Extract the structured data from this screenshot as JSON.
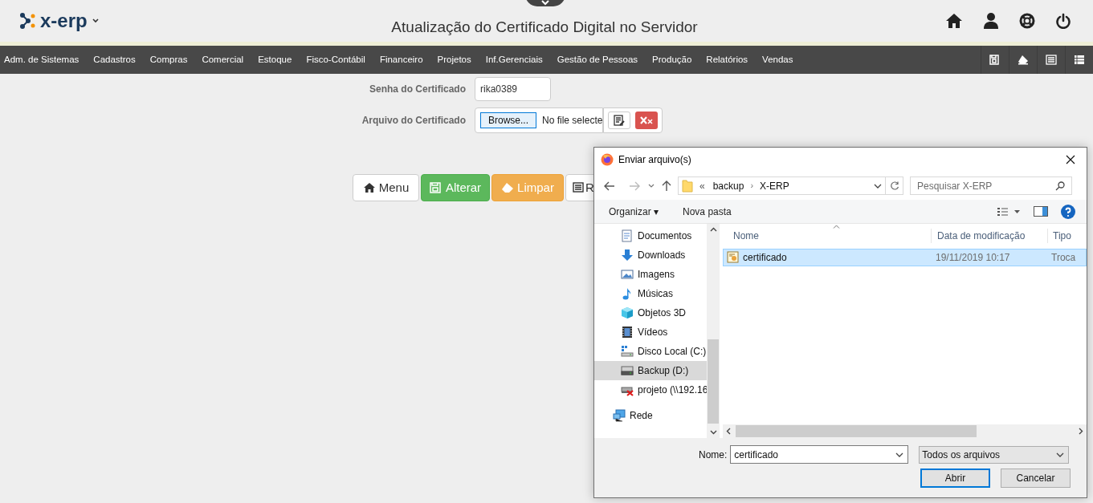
{
  "header": {
    "logo": "x-erp",
    "title": "Atualização do Certificado Digital no Servidor"
  },
  "menu": [
    {
      "label": "Adm. de Sistemas"
    },
    {
      "label": "Cadastros"
    },
    {
      "label": "Compras"
    },
    {
      "label": "Comercial"
    },
    {
      "label": "Estoque"
    },
    {
      "label": "Fisco-Contábil"
    },
    {
      "label": "Financeiro"
    },
    {
      "label": "Projetos"
    },
    {
      "label": "Inf.Gerenciais"
    },
    {
      "label": "Gestão de Pessoas"
    },
    {
      "label": "Produção"
    },
    {
      "label": "Relatórios"
    },
    {
      "label": "Vendas"
    }
  ],
  "form": {
    "password_label": "Senha do Certificado",
    "password_value": "rika0389",
    "file_label": "Arquivo do Certificado",
    "browse_button": "Browse...",
    "file_status": "No file selecte"
  },
  "buttons": [
    {
      "kind": "menu",
      "label": "Menu"
    },
    {
      "kind": "save",
      "label": "Alterar"
    },
    {
      "kind": "clear",
      "label": "Limpar"
    },
    {
      "kind": "list",
      "label": "R"
    }
  ],
  "dialog": {
    "title": "Enviar arquivo(s)",
    "path": [
      {
        "label": "«"
      },
      {
        "label": "backup"
      },
      {
        "label": "X-ERP"
      }
    ],
    "path_separator": "›",
    "search": {
      "placeholder": "Pesquisar X-ERP"
    },
    "toolbar": [
      {
        "label": "Organizar ▾"
      },
      {
        "label": "Nova pasta"
      }
    ],
    "nav": [
      {
        "kind": "document",
        "label": "Documentos",
        "selected": false
      },
      {
        "kind": "download",
        "label": "Downloads",
        "selected": false
      },
      {
        "kind": "image",
        "label": "Imagens",
        "selected": false
      },
      {
        "kind": "music",
        "label": "Músicas",
        "selected": false
      },
      {
        "kind": "cube",
        "label": "Objetos 3D",
        "selected": false
      },
      {
        "kind": "video",
        "label": "Vídeos",
        "selected": false
      },
      {
        "kind": "system-drive",
        "label": "Disco Local (C:)",
        "selected": false
      },
      {
        "kind": "drive",
        "label": "Backup (D:)",
        "selected": true
      },
      {
        "kind": "net-drive",
        "label": "projeto (\\\\192.16",
        "selected": false
      },
      {
        "kind": "network",
        "label": "Rede",
        "selected": false
      }
    ],
    "columns": [
      "Nome",
      "Data de modificação",
      "Tipo"
    ],
    "files": [
      {
        "name": "certificado",
        "modified": "19/11/2019 10:17",
        "type": "Troca",
        "selected": true
      }
    ],
    "name_label": "Nome:",
    "name_value": "certificado",
    "filter": "Todos os arquivos",
    "open_button": "Abrir",
    "cancel_button": "Cancelar"
  }
}
